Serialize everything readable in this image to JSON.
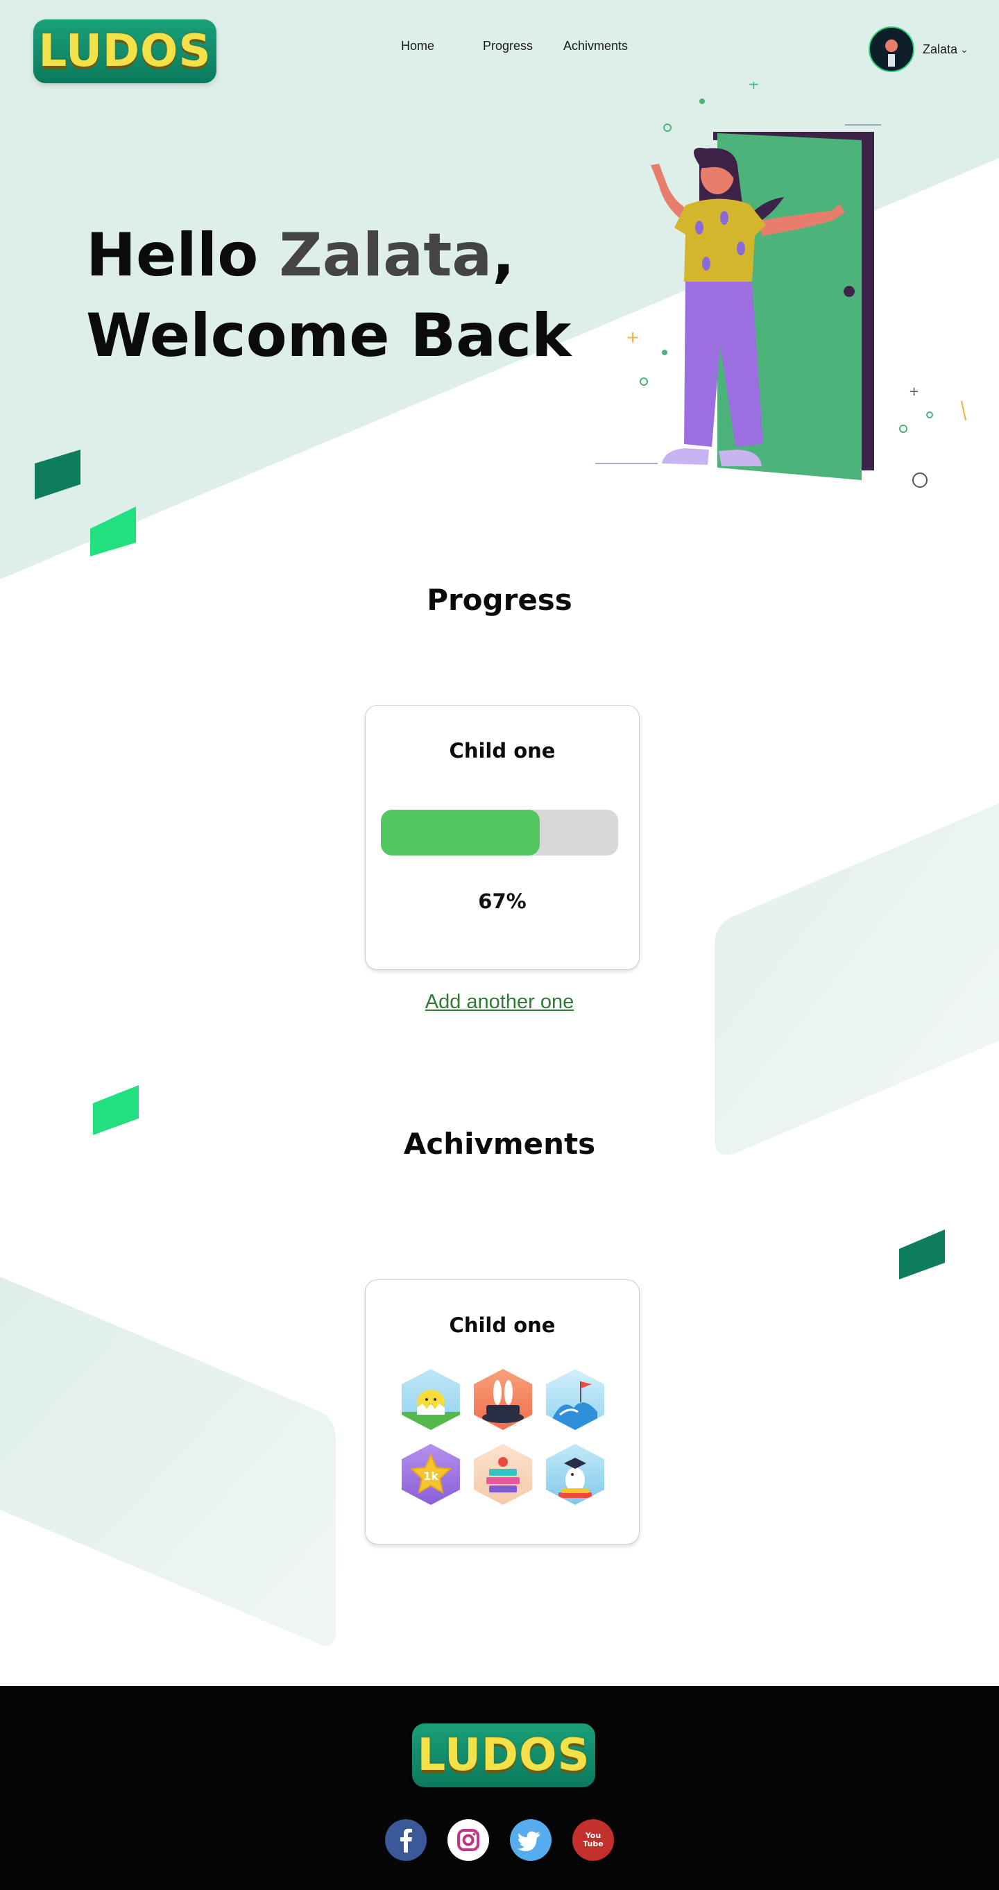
{
  "header": {
    "logo_text": "LUDOS",
    "nav": {
      "home": "Home",
      "progress": "Progress",
      "achievements": "Achivments"
    },
    "user_name": "Zalata"
  },
  "hero": {
    "greeting": "Hello ",
    "name": "Zalata",
    "comma": ",",
    "welcome": "Welcome Back"
  },
  "progress_section": {
    "title": "Progress",
    "card": {
      "child_name": "Child one",
      "progress_value": 0.67,
      "progress_label": "67%"
    },
    "add_link": "Add another one"
  },
  "achievements_section": {
    "title": "Achivments",
    "card": {
      "child_name": "Child one",
      "badges": [
        "chick-badge",
        "rabbit-hat-badge",
        "wave-flag-badge",
        "1k-star-badge",
        "books-apple-badge",
        "graduate-bird-badge"
      ],
      "badge_star_text": "1k"
    }
  },
  "footer": {
    "logo_text": "LUDOS",
    "social": [
      "facebook-icon",
      "instagram-icon",
      "twitter-icon",
      "youtube-icon"
    ],
    "youtube_text": "You Tube"
  },
  "colors": {
    "brand_green": "#0b7a5c",
    "accent_green": "#52c75f",
    "logo_yellow": "#f3e14a",
    "mint_bg": "#deefe9",
    "link_green": "#2f7a35"
  }
}
